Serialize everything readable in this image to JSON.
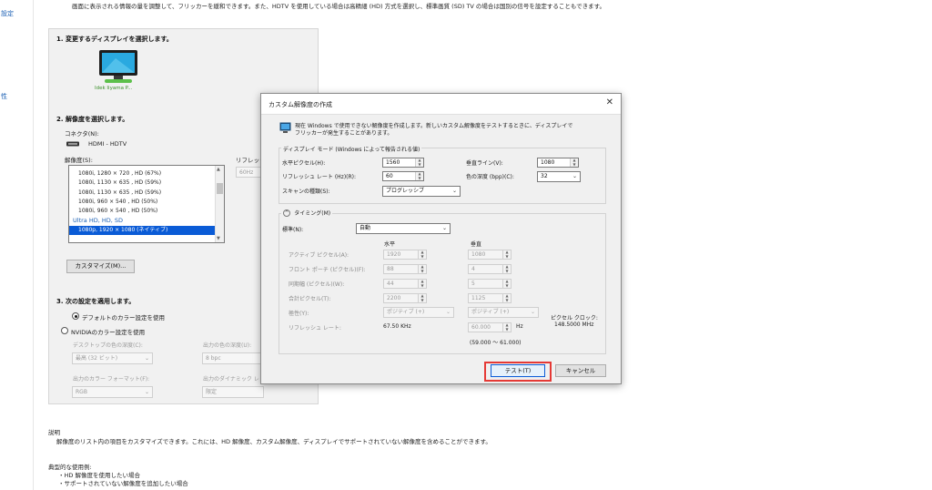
{
  "top_description": "画面に表示される情報の量を調整して、フリッカーを緩和できます。また、HDTV を使用している場合は高精細 (HD) 方式を選択し、標準画質 (SD) TV の場合は国別の信号を設定することもできます。",
  "sidebar": {
    "link1": "設定",
    "link2": "性"
  },
  "section1": {
    "title": "1. 変更するディスプレイを選択します。",
    "monitor_label": "Idek Iiyama P..."
  },
  "section2": {
    "title": "2. 解像度を選択します。",
    "connector_label": "コネクタ(N):",
    "connector_value": "HDMI - HDTV",
    "resolution_label": "解像度(S):",
    "refresh_label": "リフレッシ",
    "refresh_value": "60Hz",
    "list_items": [
      "1080i, 1280 × 720 , HD (67%)",
      "1080i, 1130 × 635 , HD (59%)",
      "1080i, 1130 × 635 , HD (59%)",
      "1080i, 960 × 540 , HD (50%)",
      "1080i, 960 × 540 , HD (50%)"
    ],
    "list_group": "Ultra HD, HD, SD",
    "list_selected": "1080p, 1920 × 1080 (ネイティブ)",
    "customize_button": "カスタマイズ(M)..."
  },
  "section3": {
    "title": "3. 次の設定を適用します。",
    "radio_default": "デフォルトのカラー設定を使用",
    "radio_nvidia": "NVIDIAのカラー設定を使用",
    "desktop_depth_label": "デスクトップの色の深度(C):",
    "desktop_depth_value": "最高 (32 ビット)",
    "output_depth_label": "出力の色の深度(U):",
    "output_depth_value": "8 bpc",
    "color_format_label": "出力のカラー フォーマット(F):",
    "color_format_value": "RGB",
    "dynamic_range_label": "出力のダイナミック レ",
    "dynamic_range_value": "限定"
  },
  "description": {
    "heading": "説明",
    "text": "解像度のリスト内の項目をカスタマイズできます。これには、HD 解像度、カスタム解像度、ディスプレイでサポートされていない解像度を含めることができます。"
  },
  "typical": {
    "heading": "典型的な使用例:",
    "items": [
      "・HD 解像度を使用したい場合",
      "・サポートされていない解像度を追加したい場合"
    ]
  },
  "dialog": {
    "title": "カスタム解像度の作成",
    "intro_line1": "現在 Windows で使用できない解像度を作成します。新しいカスタム解像度をテストするときに、ディスプレイで",
    "intro_line2": "フリッカーが発生することがあります。",
    "display_mode_legend": "ディスプレイ モード (Windows によって報告される値)",
    "h_pixels_label": "水平ピクセル(H):",
    "h_pixels_value": "1560",
    "v_lines_label": "垂直ライン(V):",
    "v_lines_value": "1080",
    "refresh_label": "リフレッシュ レート (Hz)(R):",
    "refresh_value": "60",
    "color_depth_label": "色の深度 (bpp)(C):",
    "color_depth_value": "32",
    "scan_label": "スキャンの種類(S):",
    "scan_value": "プログレッシブ",
    "timing_legend": "タイミング(M)",
    "standard_label": "標準(N):",
    "standard_value": "自動",
    "col_horizontal": "水平",
    "col_vertical": "垂直",
    "active_label": "アクティブ ピクセル(A):",
    "active_h": "1920",
    "active_v": "1080",
    "front_porch_label": "フロント ポーチ (ピクセル)(F):",
    "front_porch_h": "88",
    "front_porch_v": "4",
    "sync_width_label": "同期幅 (ピクセル)(W):",
    "sync_width_h": "44",
    "sync_width_v": "5",
    "total_label": "合計ピクセル(T):",
    "total_h": "2200",
    "total_v": "1125",
    "polarity_label": "極性(Y):",
    "polarity_h": "ポジティブ (+)",
    "polarity_v": "ポジティブ (+)",
    "pixel_clock_label": "ピクセル クロック:",
    "pixel_clock_value": "148.5000 MHz",
    "refresh_row_label": "リフレッシュ レート:",
    "refresh_h_value": "67.50 KHz",
    "refresh_v_value": "60.000",
    "refresh_v_unit": "Hz",
    "refresh_range": "(59.000 ～ 61.000)",
    "test_button": "テスト(T)",
    "cancel_button": "キャンセル"
  },
  "colors": {
    "highlight": "#e53935",
    "selection": "#0a5bd6",
    "link": "#1a5fb4"
  }
}
